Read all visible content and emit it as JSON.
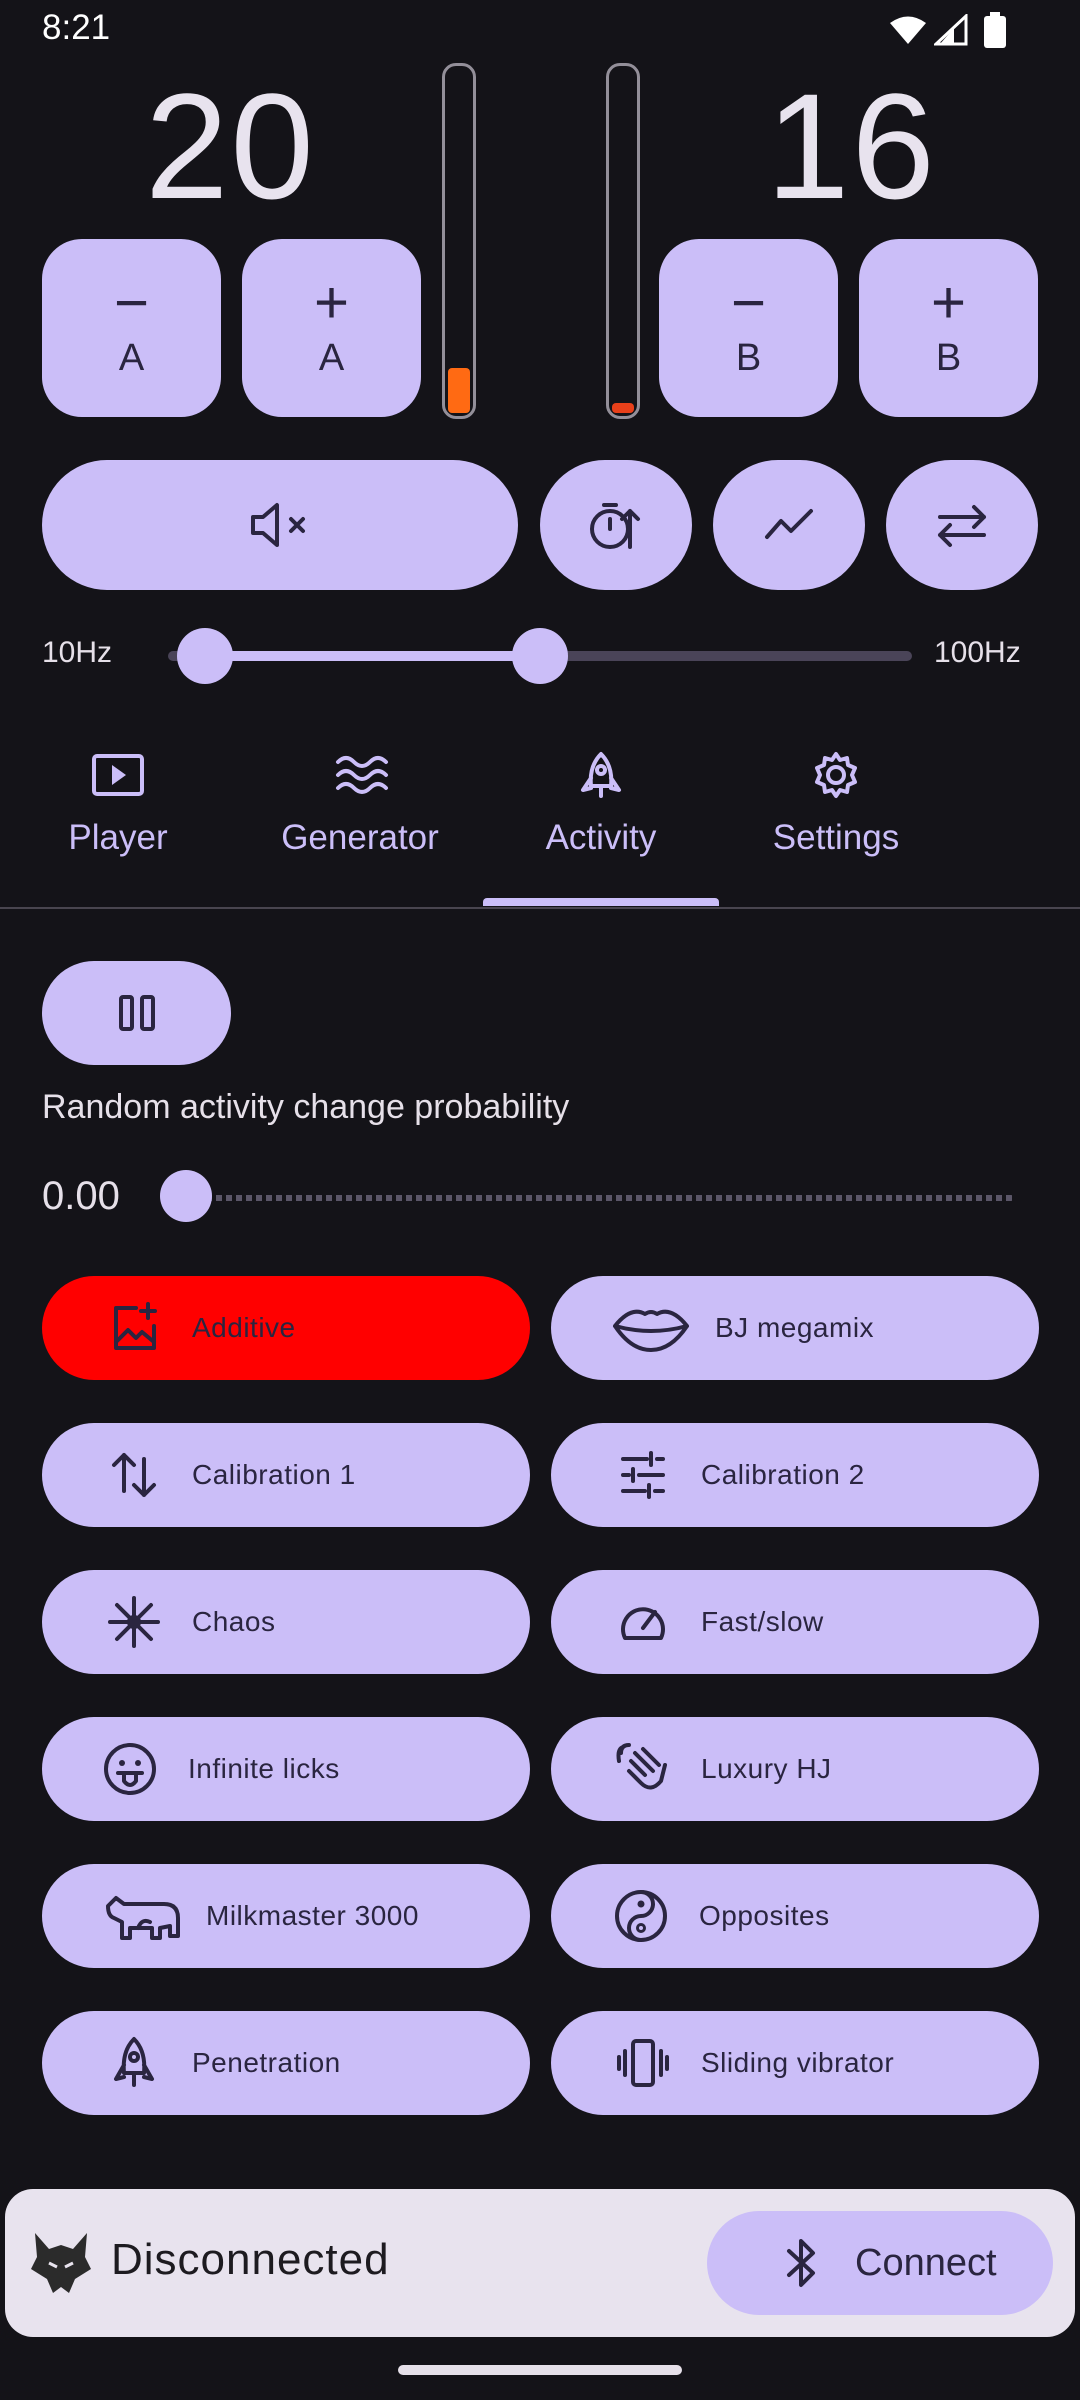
{
  "status_bar": {
    "time": "8:21",
    "icons": [
      "wifi-icon",
      "signal-icon",
      "battery-icon"
    ]
  },
  "channel_a": {
    "value": "20",
    "minus_symbol": "−",
    "minus_label": "A",
    "plus_symbol": "+",
    "plus_label": "A",
    "meter_level": 0.13
  },
  "channel_b": {
    "value": "16",
    "minus_symbol": "−",
    "minus_label": "B",
    "plus_symbol": "+",
    "plus_label": "B",
    "meter_level": 0.03
  },
  "controls": {
    "mute_icon": "volume-off-icon",
    "timer_icon": "timer-up-icon",
    "graph_icon": "trend-line-icon",
    "swap_icon": "swap-arrows-icon"
  },
  "frequency": {
    "min_label": "10Hz",
    "max_label": "100Hz",
    "low_fraction": 0.05,
    "high_fraction": 0.5
  },
  "tabs": [
    {
      "label": "Player",
      "icon": "play-box-icon"
    },
    {
      "label": "Generator",
      "icon": "waves-icon"
    },
    {
      "label": "Activity",
      "icon": "rocket-icon",
      "selected": true
    },
    {
      "label": "Settings",
      "icon": "gear-icon"
    }
  ],
  "activity": {
    "pause_icon": "pause-icon",
    "probability_label": "Random activity change probability",
    "probability_value": "0.00",
    "probability_fraction": 0.0,
    "items": [
      {
        "label": "Additive",
        "icon": "add-photo-icon",
        "active": true,
        "active_color": "#ff0000"
      },
      {
        "label": "BJ megamix",
        "icon": "lips-icon"
      },
      {
        "label": "Calibration 1",
        "icon": "swap-vertical-icon"
      },
      {
        "label": "Calibration 2",
        "icon": "tune-icon"
      },
      {
        "label": "Chaos",
        "icon": "starburst-icon"
      },
      {
        "label": "Fast/slow",
        "icon": "speedometer-icon"
      },
      {
        "label": "Infinite licks",
        "icon": "tongue-face-icon"
      },
      {
        "label": "Luxury HJ",
        "icon": "hand-wave-icon"
      },
      {
        "label": "Milkmaster 3000",
        "icon": "cow-icon"
      },
      {
        "label": "Opposites",
        "icon": "yin-yang-icon"
      },
      {
        "label": "Penetration",
        "icon": "rocket-icon"
      },
      {
        "label": "Sliding vibrator",
        "icon": "vibrate-icon"
      }
    ]
  },
  "connection": {
    "status": "Disconnected",
    "button_label": "Connect",
    "logo_icon": "wolf-logo-icon",
    "button_icon": "bluetooth-icon"
  },
  "colors": {
    "background": "#141318",
    "accent": "#cbbef8",
    "meter_fill": "#ff6a13",
    "active": "#ff0000"
  }
}
